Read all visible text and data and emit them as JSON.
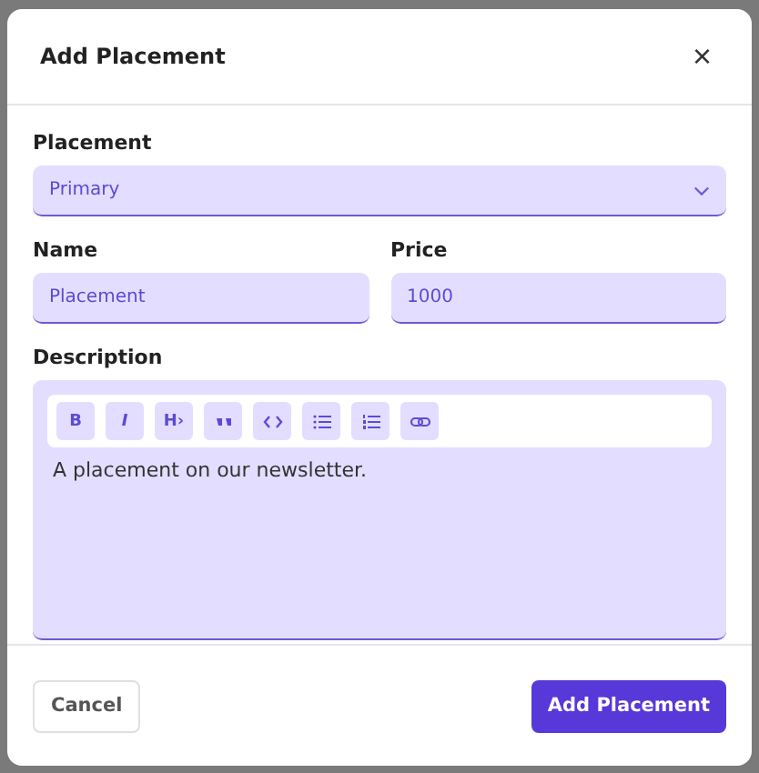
{
  "dialog": {
    "title": "Add Placement",
    "close": "×"
  },
  "fields": [
    {
      "kind": "select",
      "label": "Placement",
      "value": "Primary"
    },
    {
      "kind": "text",
      "label": "Name",
      "value": "Placement"
    },
    {
      "kind": "text",
      "label": "Price",
      "value": "1000"
    }
  ],
  "description": {
    "label": "Description",
    "toolbar": [
      {
        "kind": "bold",
        "label": "B"
      },
      {
        "kind": "italic",
        "label": "I"
      },
      {
        "kind": "heading",
        "label": "H›"
      },
      {
        "kind": "quote"
      },
      {
        "kind": "code"
      },
      {
        "kind": "bullets"
      },
      {
        "kind": "numbers"
      },
      {
        "kind": "link"
      }
    ],
    "text": "A placement on our newsletter."
  },
  "buttons": [
    {
      "label": "Cancel",
      "kind": "secondary"
    },
    {
      "label": "Add Placement",
      "kind": "primary"
    }
  ]
}
